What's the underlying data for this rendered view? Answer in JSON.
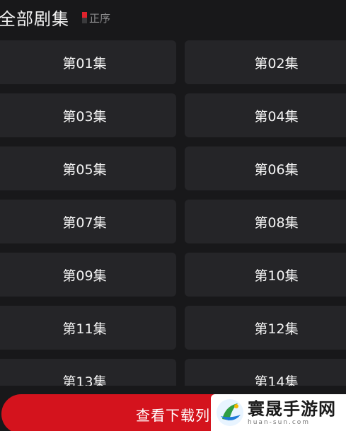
{
  "header": {
    "title": "全部剧集",
    "sort_label": "正序",
    "sort_icon": "sort-order-icon"
  },
  "episodes": [
    "第01集",
    "第02集",
    "第03集",
    "第04集",
    "第05集",
    "第06集",
    "第07集",
    "第08集",
    "第09集",
    "第10集",
    "第11集",
    "第12集",
    "第13集",
    "第14集"
  ],
  "download_button": {
    "label": "查看下载列表"
  },
  "watermark": {
    "name": "寰晟手游网",
    "url": "huan-sun.com"
  },
  "colors": {
    "background": "#18181a",
    "card": "#252528",
    "accent": "#d4131d",
    "text": "#f4f4f4",
    "muted": "#8a8a8c"
  }
}
